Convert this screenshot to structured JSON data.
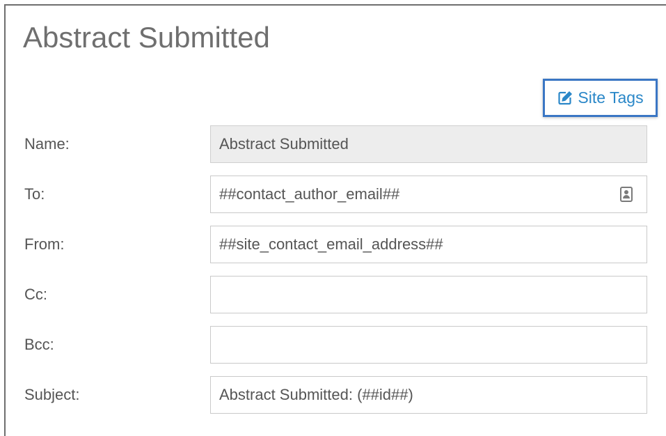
{
  "page": {
    "title": "Abstract Submitted"
  },
  "toolbar": {
    "site_tags_label": "Site Tags",
    "site_tags_icon": "edit-icon",
    "highlight_color": "#3a76c4",
    "link_color": "#2a87c8"
  },
  "form": {
    "name": {
      "label": "Name:",
      "value": "Abstract Submitted"
    },
    "to": {
      "label": "To:",
      "value": "##contact_author_email##",
      "icon": "contact-card-icon"
    },
    "from": {
      "label": "From:",
      "value": "##site_contact_email_address##"
    },
    "cc": {
      "label": "Cc:",
      "value": ""
    },
    "bcc": {
      "label": "Bcc:",
      "value": ""
    },
    "subject": {
      "label": "Subject:",
      "value": "Abstract Submitted: (##id##)"
    }
  }
}
